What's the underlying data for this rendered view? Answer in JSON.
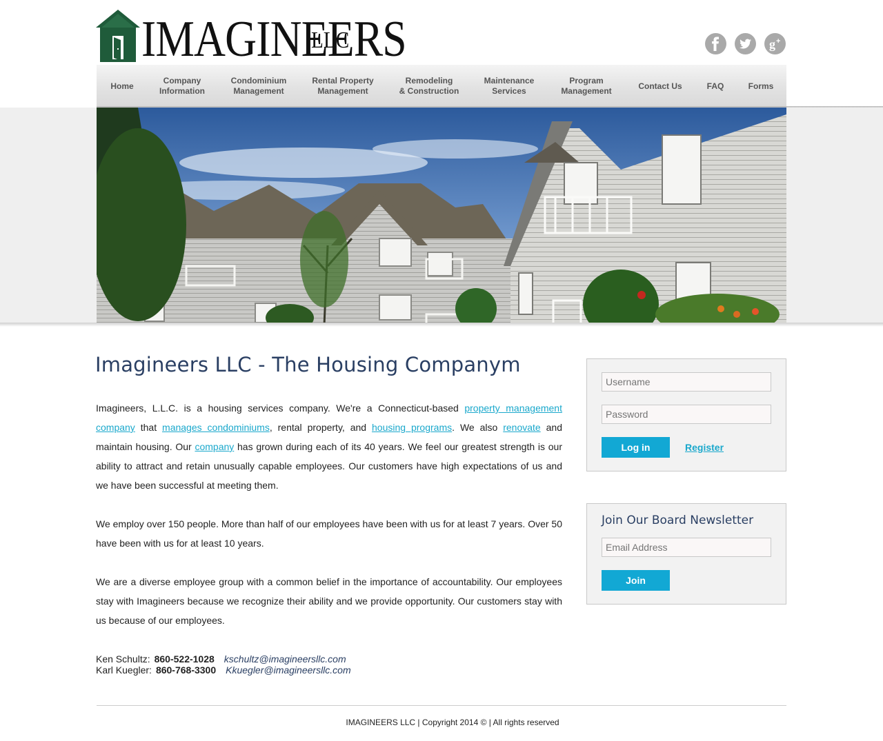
{
  "header": {
    "logo_text": "IMAGINEERS",
    "logo_suffix": "LLC",
    "social": [
      {
        "icon": "facebook-icon",
        "glyph": "f"
      },
      {
        "icon": "twitter-icon",
        "glyph": "t"
      },
      {
        "icon": "google-plus-icon",
        "glyph": "g+"
      }
    ]
  },
  "nav": {
    "items": [
      {
        "label": "Home"
      },
      {
        "label": "Company\nInformation"
      },
      {
        "label": "Condominium\nManagement"
      },
      {
        "label": "Rental Property\nManagement"
      },
      {
        "label": "Remodeling\n& Construction"
      },
      {
        "label": "Maintenance\nServices"
      },
      {
        "label": "Program\nManagement"
      },
      {
        "label": "Contact Us"
      },
      {
        "label": "FAQ"
      },
      {
        "label": "Forms"
      }
    ]
  },
  "main": {
    "title": "Imagineers LLC - The Housing Companym",
    "p1": {
      "t1": "Imagineers, L.L.C. is a housing services company. We're a Connecticut-based ",
      "l1": "property management company",
      "t2": " that ",
      "l2": "manages condominiums",
      "t3": ", rental property, and ",
      "l3": "housing programs",
      "t4": ". We also ",
      "l4": "renovate",
      "t5": " and maintain housing. Our ",
      "l5": "company",
      "t6": " has grown during each of its 40 years. We feel our greatest strength is our ability to attract and retain unusually capable employees. Our customers have high expectations of us and we have been successful at meeting them."
    },
    "p2": "We employ over 150 people. More than half of our employees have been with us for at least 7 years. Over 50 have been with us for at least 10 years.",
    "p3": "We are a diverse employee group with a common belief in the importance of accountability. Our employees stay with Imagineers because we recognize their ability and we provide opportunity. Our customers stay with us because of our employees.",
    "contacts": [
      {
        "name": "Ken Schultz:",
        "phone": "860-522-1028",
        "email": "kschultz@imagineersllc.com"
      },
      {
        "name": "Karl Kuegler:",
        "phone": "860-768-3300",
        "email": "Kkuegler@imagineersllc.com"
      }
    ]
  },
  "login": {
    "username_placeholder": "Username",
    "password_placeholder": "Password",
    "login_label": "Log in",
    "register_label": "Register"
  },
  "newsletter": {
    "title": "Join Our Board Newsletter",
    "email_placeholder": "Email Address",
    "join_label": "Join"
  },
  "footer": {
    "text": "IMAGINEERS LLC | Copyright 2014 © | All rights reserved"
  },
  "colors": {
    "accent": "#12a8d4",
    "title": "#2a3f63",
    "logo_green": "#1f5b3a"
  }
}
